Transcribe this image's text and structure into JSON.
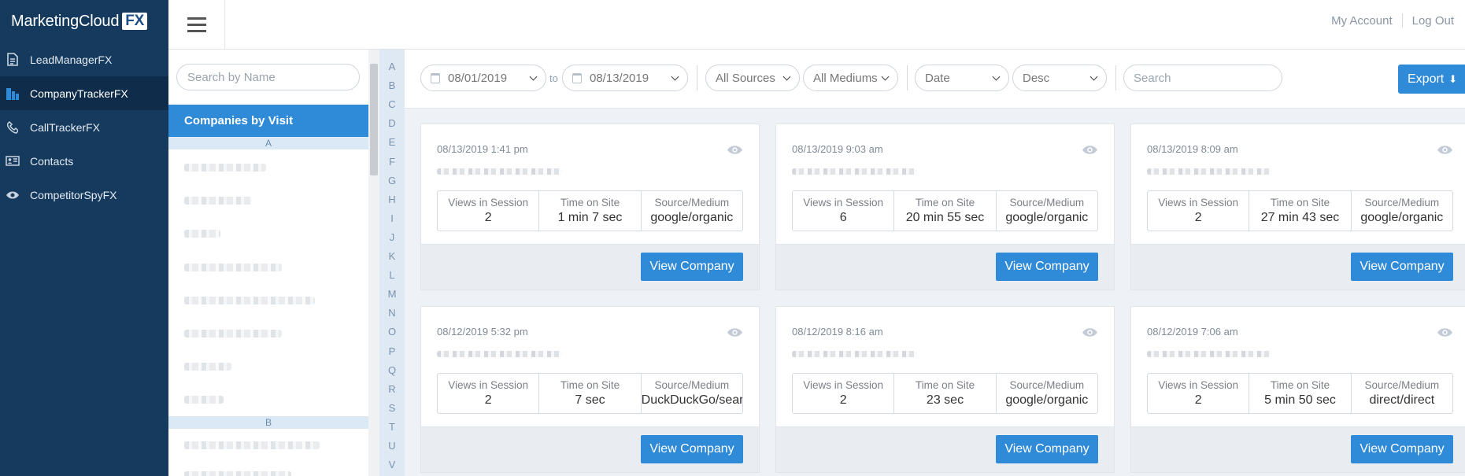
{
  "brand": {
    "name": "MarketingCloud",
    "suffix": "FX"
  },
  "nav": {
    "items": [
      {
        "label": "LeadManagerFX",
        "icon": "document-icon",
        "active": false
      },
      {
        "label": "CompanyTrackerFX",
        "icon": "buildings-icon",
        "active": true
      },
      {
        "label": "CallTrackerFX",
        "icon": "phone-icon",
        "active": false
      },
      {
        "label": "Contacts",
        "icon": "contact-card-icon",
        "active": false
      },
      {
        "label": "CompetitorSpyFX",
        "icon": "eye-icon",
        "active": false
      }
    ]
  },
  "header": {
    "my_account": "My Account",
    "log_out": "Log Out"
  },
  "list": {
    "search_placeholder": "Search by Name",
    "title": "Companies by Visit",
    "sections": [
      "A",
      "B"
    ]
  },
  "alphabet": [
    "A",
    "B",
    "C",
    "D",
    "E",
    "F",
    "G",
    "H",
    "I",
    "J",
    "K",
    "L",
    "M",
    "N",
    "O",
    "P",
    "Q",
    "R",
    "S",
    "T",
    "U",
    "V"
  ],
  "filters": {
    "date_from": "08/01/2019",
    "to_label": "to",
    "date_to": "08/13/2019",
    "sources": "All Sources",
    "mediums": "All Mediums",
    "sort_field": "Date",
    "sort_order": "Desc",
    "search_placeholder": "Search",
    "export_label": "Export"
  },
  "stat_labels": {
    "views": "Views in Session",
    "time": "Time on Site",
    "source": "Source/Medium"
  },
  "cards": [
    {
      "date": "08/13/2019 1:41 pm",
      "views": "2",
      "time": "1 min 7 sec",
      "source": "google/organic",
      "button": "View Company"
    },
    {
      "date": "08/13/2019 9:03 am",
      "views": "6",
      "time": "20 min 55 sec",
      "source": "google/organic",
      "button": "View Company"
    },
    {
      "date": "08/13/2019 8:09 am",
      "views": "2",
      "time": "27 min 43 sec",
      "source": "google/organic",
      "button": "View Company"
    },
    {
      "date": "08/12/2019 5:32 pm",
      "views": "2",
      "time": "7 sec",
      "source": "DuckDuckGo/search",
      "button": "View Company"
    },
    {
      "date": "08/12/2019 8:16 am",
      "views": "2",
      "time": "23 sec",
      "source": "google/organic",
      "button": "View Company"
    },
    {
      "date": "08/12/2019 7:06 am",
      "views": "2",
      "time": "5 min 50 sec",
      "source": "direct/direct",
      "button": "View Company"
    }
  ],
  "colors": {
    "nav_bg": "#163a5e",
    "accent": "#2f8ad8",
    "page_bg": "#eef1f5"
  }
}
